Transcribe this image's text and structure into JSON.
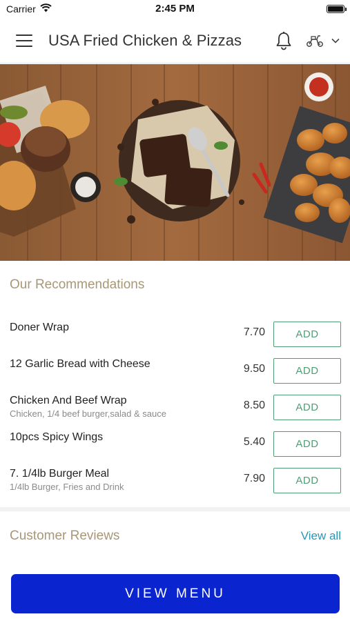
{
  "status": {
    "carrier": "Carrier",
    "time": "2:45 PM"
  },
  "header": {
    "title": "USA Fried Chicken & Pizzas"
  },
  "recommendations": {
    "title": "Our Recommendations",
    "items": [
      {
        "name": "Doner Wrap",
        "desc": "",
        "price": "7.70",
        "button": "ADD"
      },
      {
        "name": "12 Garlic Bread with Cheese",
        "desc": "",
        "price": "9.50",
        "button": "ADD"
      },
      {
        "name": "Chicken And Beef Wrap",
        "desc": "Chicken, 1/4 beef burger,salad & sauce",
        "price": "8.50",
        "button": "ADD"
      },
      {
        "name": "10pcs Spicy Wings",
        "desc": "",
        "price": "5.40",
        "button": "ADD"
      },
      {
        "name": "7. 1/4lb Burger Meal",
        "desc": "1/4lb Burger, Fries and Drink",
        "price": "7.90",
        "button": "ADD"
      }
    ]
  },
  "reviews": {
    "title": "Customer Reviews",
    "view_all": "View all"
  },
  "cta": {
    "label": "VIEW MENU"
  },
  "colors": {
    "accent_gold": "#a89776",
    "add_green": "#4f9e73",
    "link_teal": "#2a95b6",
    "cta_blue": "#0a24d0"
  },
  "icons": [
    "wifi-icon",
    "battery-icon",
    "hamburger-menu-icon",
    "bell-icon",
    "scooter-icon",
    "chevron-down-icon"
  ]
}
